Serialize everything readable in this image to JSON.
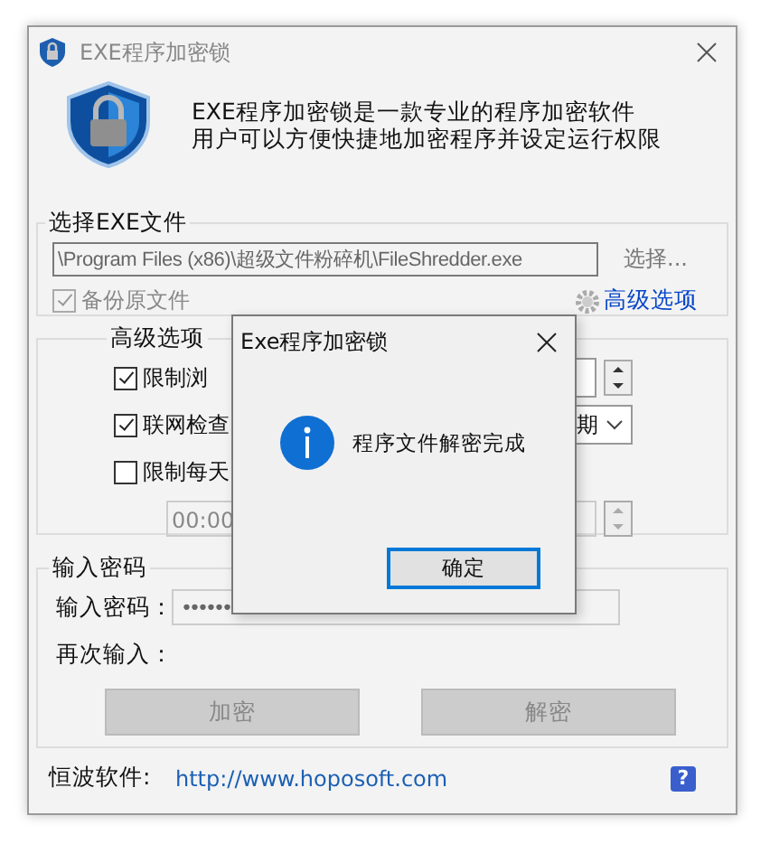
{
  "window": {
    "title": "EXE程序加密锁"
  },
  "header": {
    "lines": [
      "EXE程序加密锁是一款专业的程序加密软件",
      "用户可以方便快捷地加密程序并设定运行权限"
    ]
  },
  "file_group": {
    "title": "选择EXE文件",
    "path": "\\Program Files (x86)\\超级文件粉碎机\\FileShredder.exe",
    "browse": "选择...",
    "backup": {
      "label": "备份原文件",
      "checked": true,
      "disabled": true
    },
    "advanced_link": "高级选项"
  },
  "advanced_group": {
    "title": "高级选项",
    "options": [
      {
        "label": "限制浏",
        "checked": true
      },
      {
        "label": "联网检查",
        "checked": true
      },
      {
        "label": "限制每天",
        "checked": false
      }
    ],
    "combo_value": "期",
    "time_value": "00:00"
  },
  "password_group": {
    "title": "输入密码",
    "fields": [
      {
        "label": "输入密码：",
        "value": "••••••"
      },
      {
        "label": "再次输入："
      }
    ],
    "buttons": [
      {
        "label": "加密",
        "disabled": true
      },
      {
        "label": "解密",
        "disabled": true
      }
    ]
  },
  "footer": {
    "label": "恒波软件:",
    "link": "http://www.hoposoft.com",
    "help": "?"
  },
  "dialog": {
    "title": "Exe程序加密锁",
    "message": "程序文件解密完成",
    "button": "确定"
  }
}
